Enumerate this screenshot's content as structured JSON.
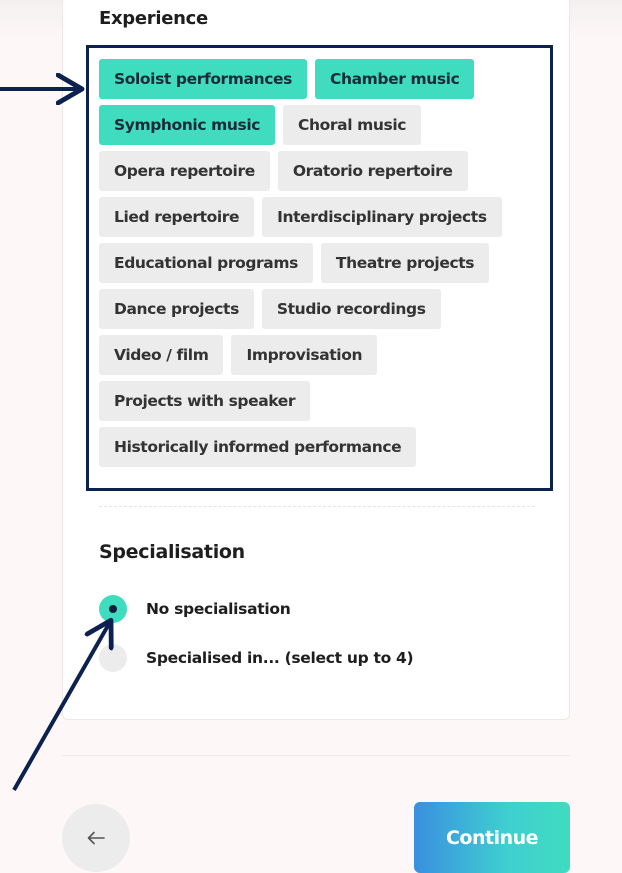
{
  "experience": {
    "title": "Experience",
    "rows": [
      [
        {
          "label": "Soloist performances",
          "selected": true
        },
        {
          "label": "Chamber music",
          "selected": true
        }
      ],
      [
        {
          "label": "Symphonic music",
          "selected": true
        },
        {
          "label": "Choral music",
          "selected": false
        }
      ],
      [
        {
          "label": "Opera repertoire",
          "selected": false
        },
        {
          "label": "Oratorio repertoire",
          "selected": false
        }
      ],
      [
        {
          "label": "Lied repertoire",
          "selected": false
        },
        {
          "label": "Interdisciplinary projects",
          "selected": false
        }
      ],
      [
        {
          "label": "Educational programs",
          "selected": false
        },
        {
          "label": "Theatre projects",
          "selected": false
        }
      ],
      [
        {
          "label": "Dance projects",
          "selected": false
        },
        {
          "label": "Studio recordings",
          "selected": false
        }
      ],
      [
        {
          "label": "Video / film",
          "selected": false
        },
        {
          "label": "Improvisation",
          "selected": false
        }
      ],
      [
        {
          "label": "Projects with speaker",
          "selected": false
        }
      ],
      [
        {
          "label": "Historically informed performance",
          "selected": false
        }
      ]
    ]
  },
  "specialisation": {
    "title": "Specialisation",
    "options": [
      {
        "label": "No specialisation",
        "checked": true
      },
      {
        "label": "Specialised in... (select up to 4)",
        "checked": false
      }
    ]
  },
  "footer": {
    "back_icon": "arrow-left-icon",
    "continue_label": "Continue"
  },
  "colors": {
    "selected_chip": "#3fdcc0",
    "chip": "#ececec",
    "highlight_border": "#0d2150",
    "annotation_arrow": "#0d2150"
  }
}
